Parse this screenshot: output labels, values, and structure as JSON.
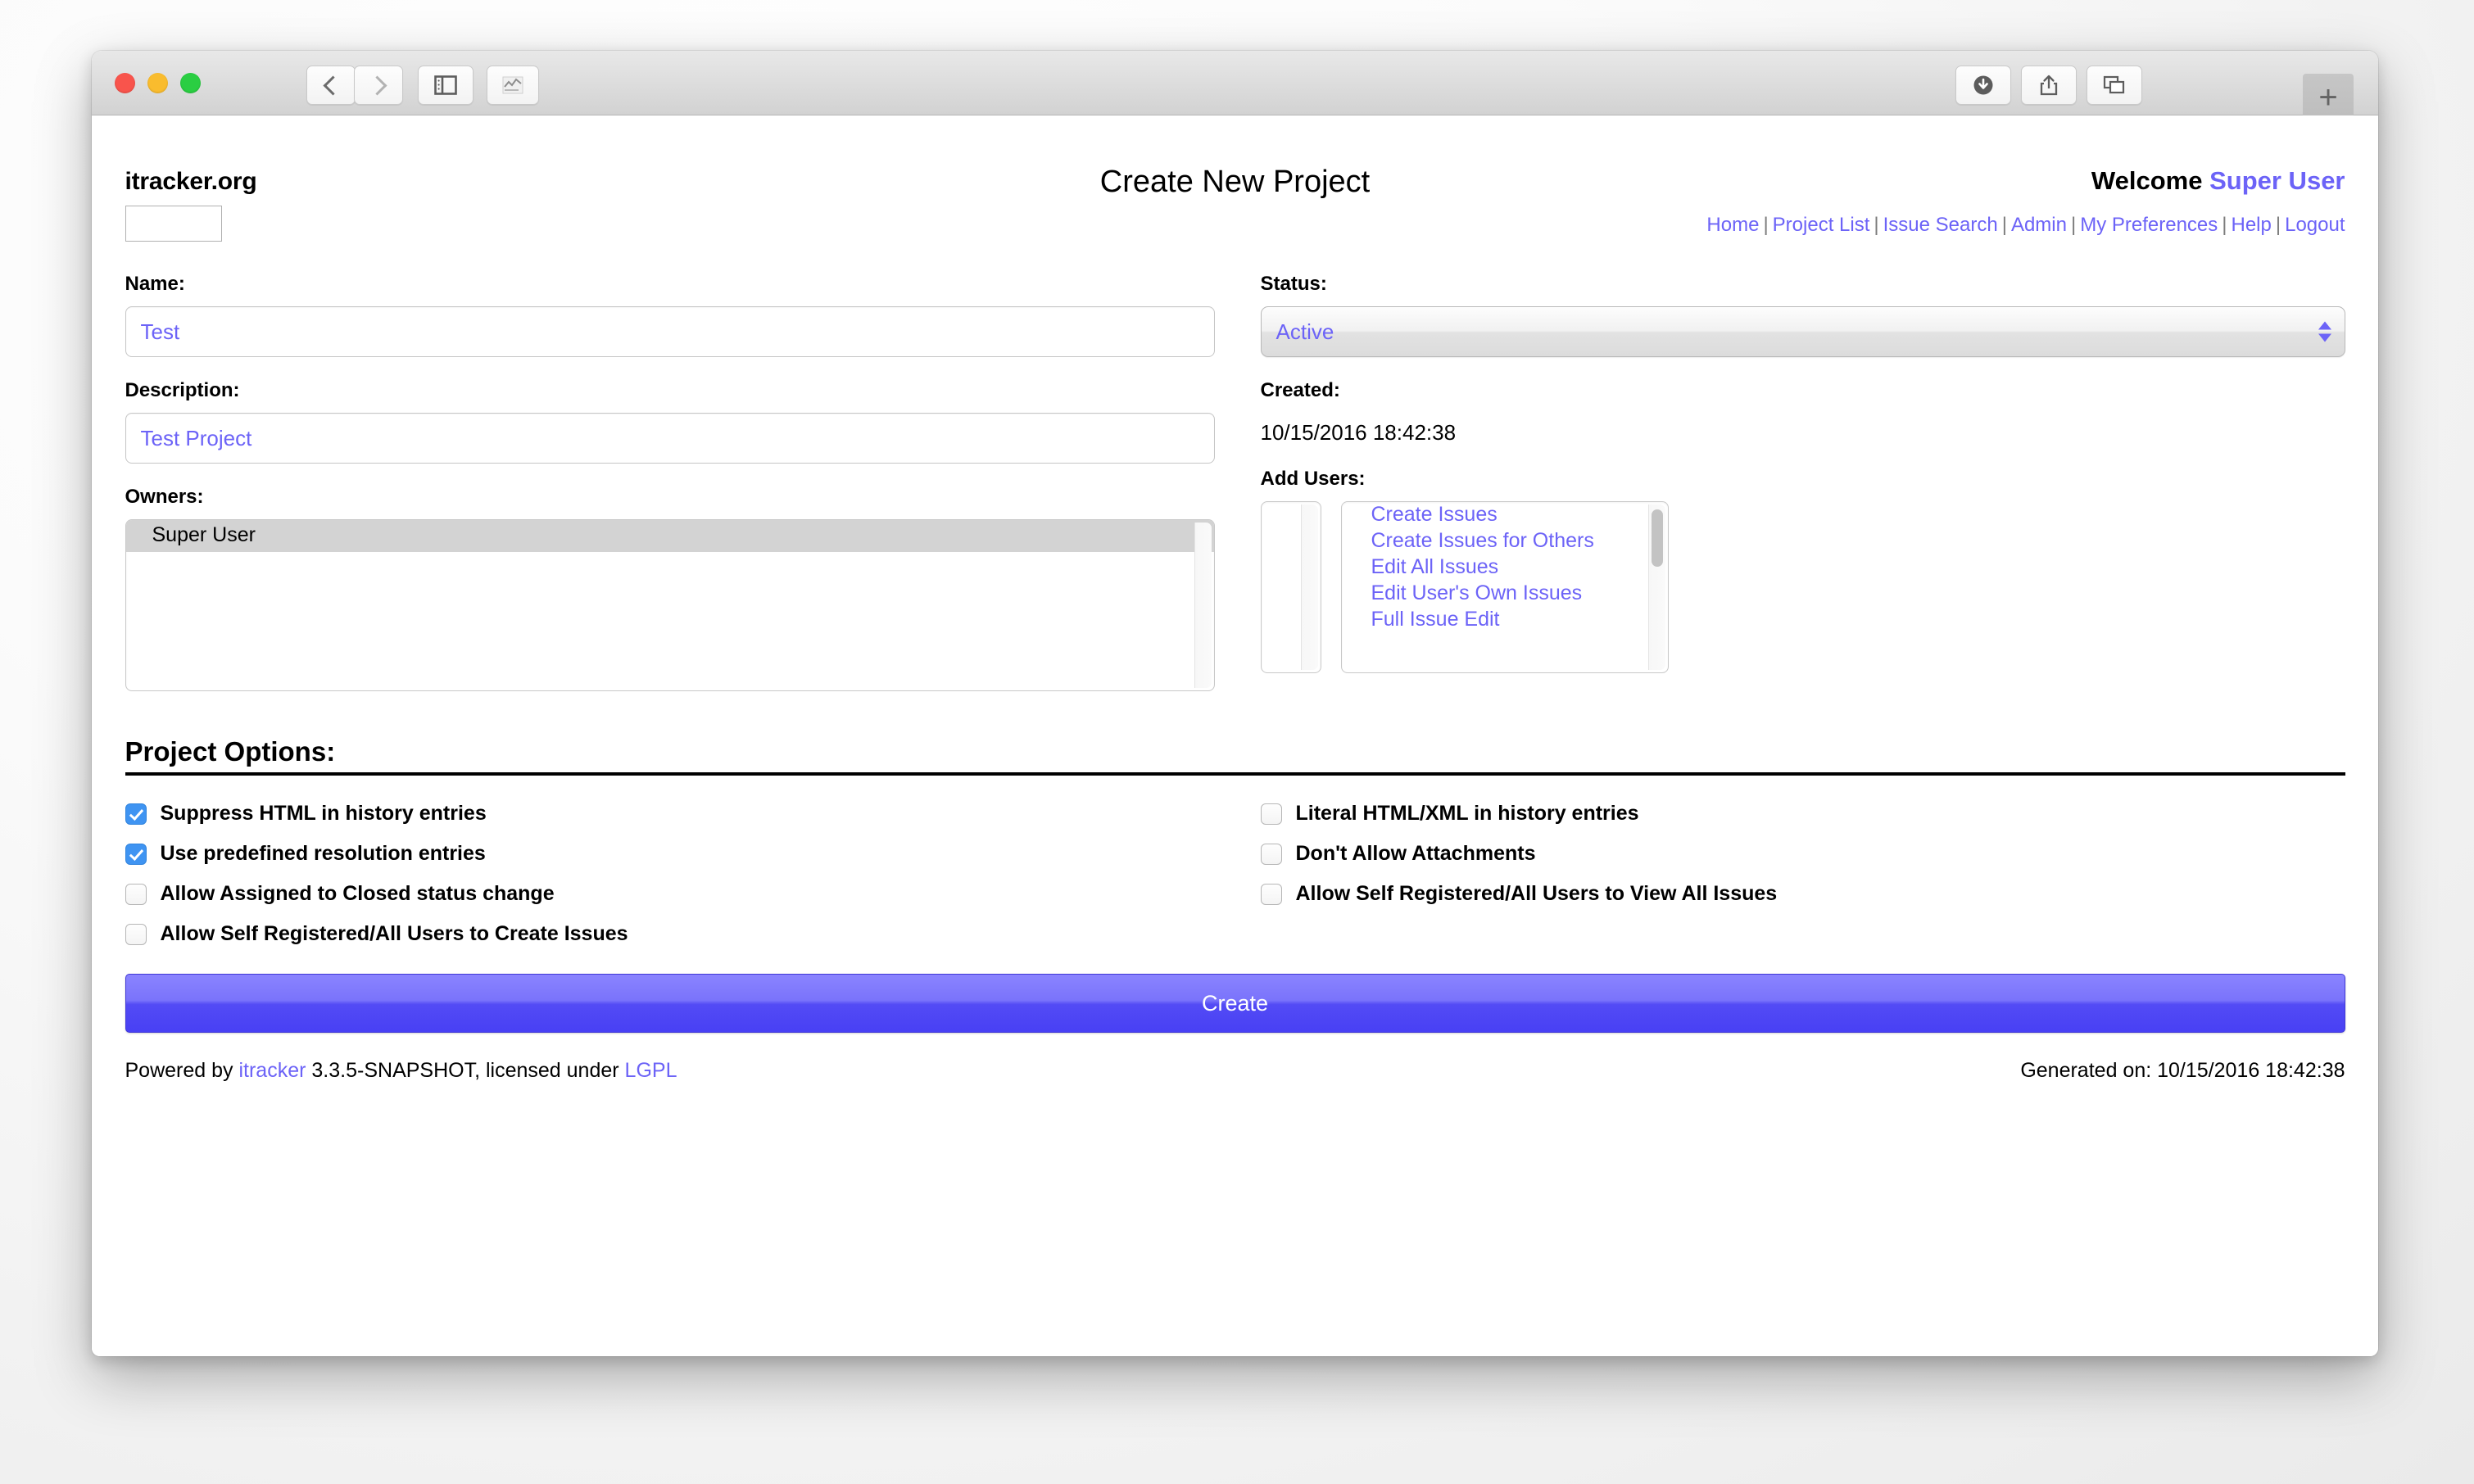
{
  "window": {
    "traffic_lights": [
      "close",
      "minimize",
      "zoom"
    ],
    "toolbar_icons": [
      "back-chevron",
      "forward-chevron",
      "sidebar",
      "reader",
      "downloads",
      "share",
      "tab-overview",
      "new-tab"
    ],
    "new_tab_label": "+"
  },
  "header": {
    "brand": "itracker.org",
    "title": "Create New Project",
    "welcome_prefix": "Welcome",
    "welcome_user": "Super User",
    "nav": [
      {
        "label": "Home"
      },
      {
        "label": "Project List"
      },
      {
        "label": "Issue Search"
      },
      {
        "label": "Admin"
      },
      {
        "label": "My Preferences"
      },
      {
        "label": "Help"
      },
      {
        "label": "Logout"
      }
    ],
    "nav_separator": "|"
  },
  "form": {
    "name": {
      "label": "Name:",
      "value": "Test",
      "placeholder": ""
    },
    "description": {
      "label": "Description:",
      "value": "Test Project",
      "placeholder": ""
    },
    "status": {
      "label": "Status:",
      "value": "Active",
      "options": [
        "Active"
      ]
    },
    "created": {
      "label": "Created:",
      "value": "10/15/2016 18:42:38"
    },
    "owners": {
      "label": "Owners:",
      "items": [
        {
          "label": "Super User",
          "selected": true
        }
      ]
    },
    "add_users": {
      "label": "Add Users:",
      "users": [],
      "permissions": [
        "Create Issues",
        "Create Issues for Others",
        "Edit All Issues",
        "Edit User's Own Issues",
        "Full Issue Edit"
      ]
    }
  },
  "project_options": {
    "title": "Project Options:",
    "left": [
      {
        "label": "Suppress HTML in history entries",
        "checked": true
      },
      {
        "label": "Use predefined resolution entries",
        "checked": true
      },
      {
        "label": "Allow Assigned to Closed status change",
        "checked": false
      },
      {
        "label": "Allow Self Registered/All Users to Create Issues",
        "checked": false
      }
    ],
    "right": [
      {
        "label": "Literal HTML/XML in history entries",
        "checked": false
      },
      {
        "label": "Don't Allow Attachments",
        "checked": false
      },
      {
        "label": "Allow Self Registered/All Users to View All Issues",
        "checked": false
      }
    ]
  },
  "submit": {
    "label": "Create"
  },
  "footer": {
    "powered_prefix": "Powered by",
    "powered_link": "itracker",
    "version_text": "3.3.5-SNAPSHOT, licensed under",
    "license_link": "LGPL",
    "generated": "Generated on: 10/15/2016 18:42:38"
  },
  "colors": {
    "accent": "#6c63f7",
    "button": "#4840f4",
    "checkbox": "#3f94f2"
  }
}
